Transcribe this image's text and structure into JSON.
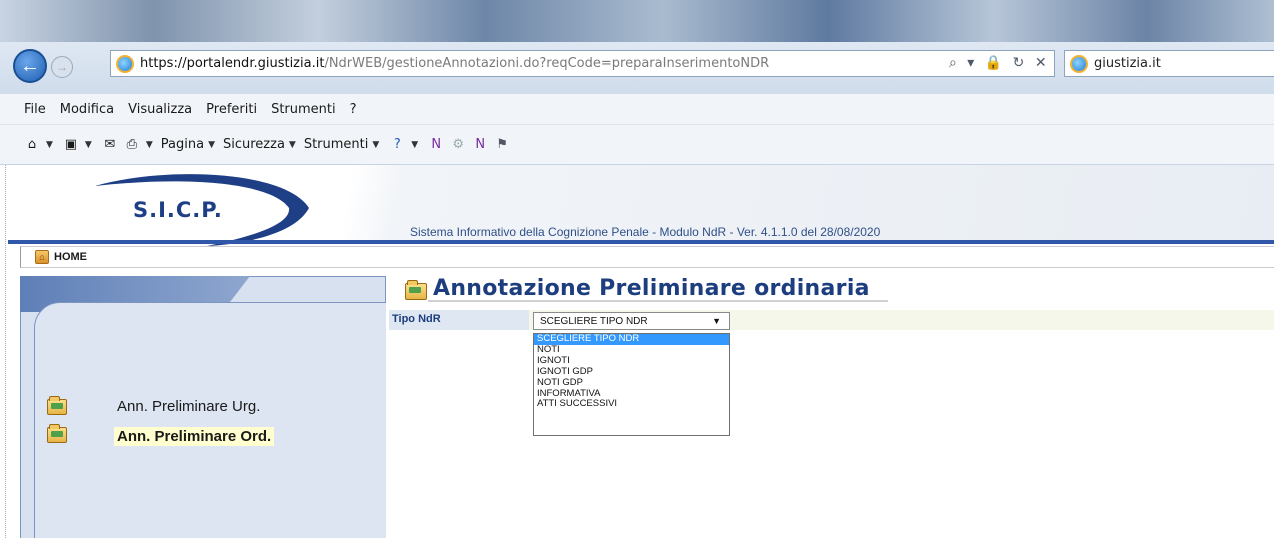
{
  "browser": {
    "url_host": "https://portalendr.giustizia.it",
    "url_path": "/NdrWEB/gestioneAnnotazioni.do?reqCode=preparaInserimentoNDR",
    "address_controls": "⌕ ▾ 🔒 ↻ ✕",
    "tab_title": "giustizia.it",
    "menu": [
      "File",
      "Modifica",
      "Visualizza",
      "Preferiti",
      "Strumenti",
      "?"
    ],
    "command_bar": {
      "page_label": "Pagina",
      "security_label": "Sicurezza",
      "tools_label": "Strumenti"
    }
  },
  "app": {
    "logo_text": "S.I.C.P.",
    "system_title": "Sistema Informativo della Cognizione Penale - Modulo NdR - Ver. 4.1.1.0 del 28/08/2020",
    "home_label": "HOME",
    "sidebar": {
      "items": [
        {
          "label": "Ann. Preliminare Urg.",
          "active": false
        },
        {
          "label": "Ann. Preliminare Ord.",
          "active": true
        }
      ]
    },
    "content": {
      "title": "Annotazione Preliminare ordinaria",
      "field_label": "Tipo NdR",
      "select_value": "SCEGLIERE TIPO NDR",
      "options": [
        "SCEGLIERE TIPO NDR",
        "NOTI",
        "IGNOTI",
        "IGNOTI GDP",
        "NOTI GDP",
        "INFORMATIVA",
        "ATTI SUCCESSIVI"
      ],
      "highlighted_option": "SCEGLIERE TIPO NDR"
    }
  },
  "colors": {
    "accent_blue": "#1c3d7e",
    "selection_blue": "#3399ff",
    "active_item_bg": "#ffffcf"
  }
}
